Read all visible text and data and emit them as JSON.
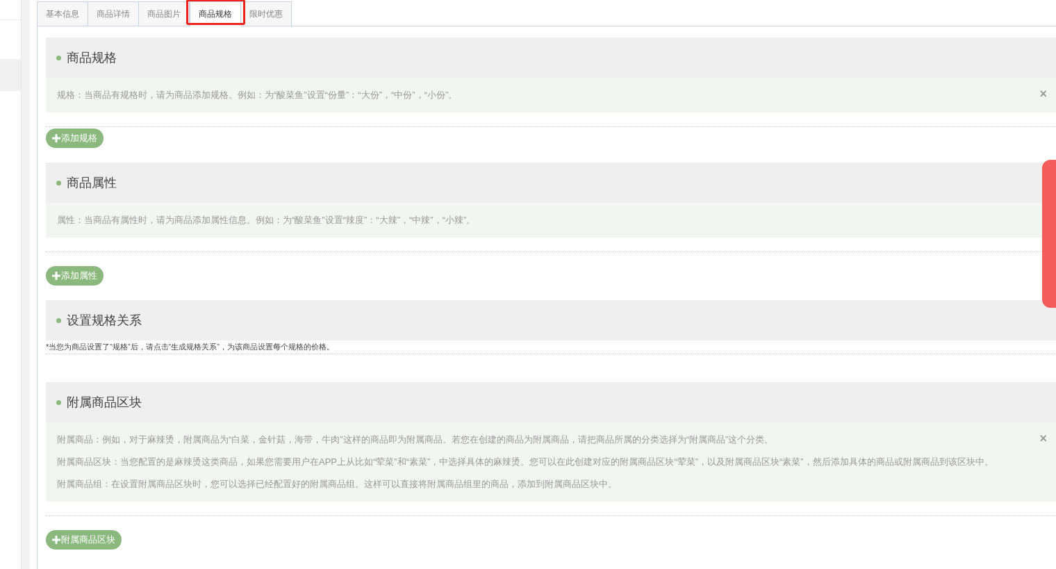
{
  "tabs": [
    {
      "label": "基本信息",
      "selected": false
    },
    {
      "label": "商品详情",
      "selected": false
    },
    {
      "label": "商品图片",
      "selected": false
    },
    {
      "label": "商品规格",
      "selected": true
    },
    {
      "label": "限时优惠",
      "selected": false
    }
  ],
  "sections": [
    {
      "title": "商品规格",
      "notice": {
        "paragraphs": [
          "规格：当商品有规格时，请为商品添加规格。例如：为“酸菜鱼”设置“份量”：“大份”，“中份”，“小份”。"
        ],
        "close": "×"
      },
      "button": "添加规格"
    },
    {
      "title": "商品属性",
      "notice": {
        "paragraphs": [
          "属性：当商品有属性时，请为商品添加属性信息。例如：为“酸菜鱼”设置“辣度”：“大辣”，“中辣”，“小辣”。"
        ]
      },
      "button": "添加属性"
    },
    {
      "title": "设置规格关系",
      "note": "*当您为商品设置了“规格”后，请点击“生成规格关系”，为该商品设置每个规格的价格。"
    },
    {
      "title": "附属商品区块",
      "notice": {
        "paragraphs": [
          "附属商品：例如，对于麻辣烫，附属商品为“白菜，金针菇，海带，牛肉”这样的商品即为附属商品。若您在创建的商品为附属商品，请把商品所属的分类选择为“附属商品”这个分类。",
          "附属商品区块：当您配置的是麻辣烫这类商品，如果您需要用户在APP上从比如“荤菜”和“素菜”，中选择具体的麻辣烫。您可以在此创建对应的附属商品区块“荤菜”，以及附属商品区块“素菜”，然后添加具体的商品或附属商品到该区块中。",
          "附属商品组：在设置附属商品区块时，您可以选择已经配置好的附属商品组。这样可以直接将附属商品组里的商品，添加到附属商品区块中。"
        ],
        "close": "×"
      },
      "button": "附属商品区块"
    }
  ]
}
